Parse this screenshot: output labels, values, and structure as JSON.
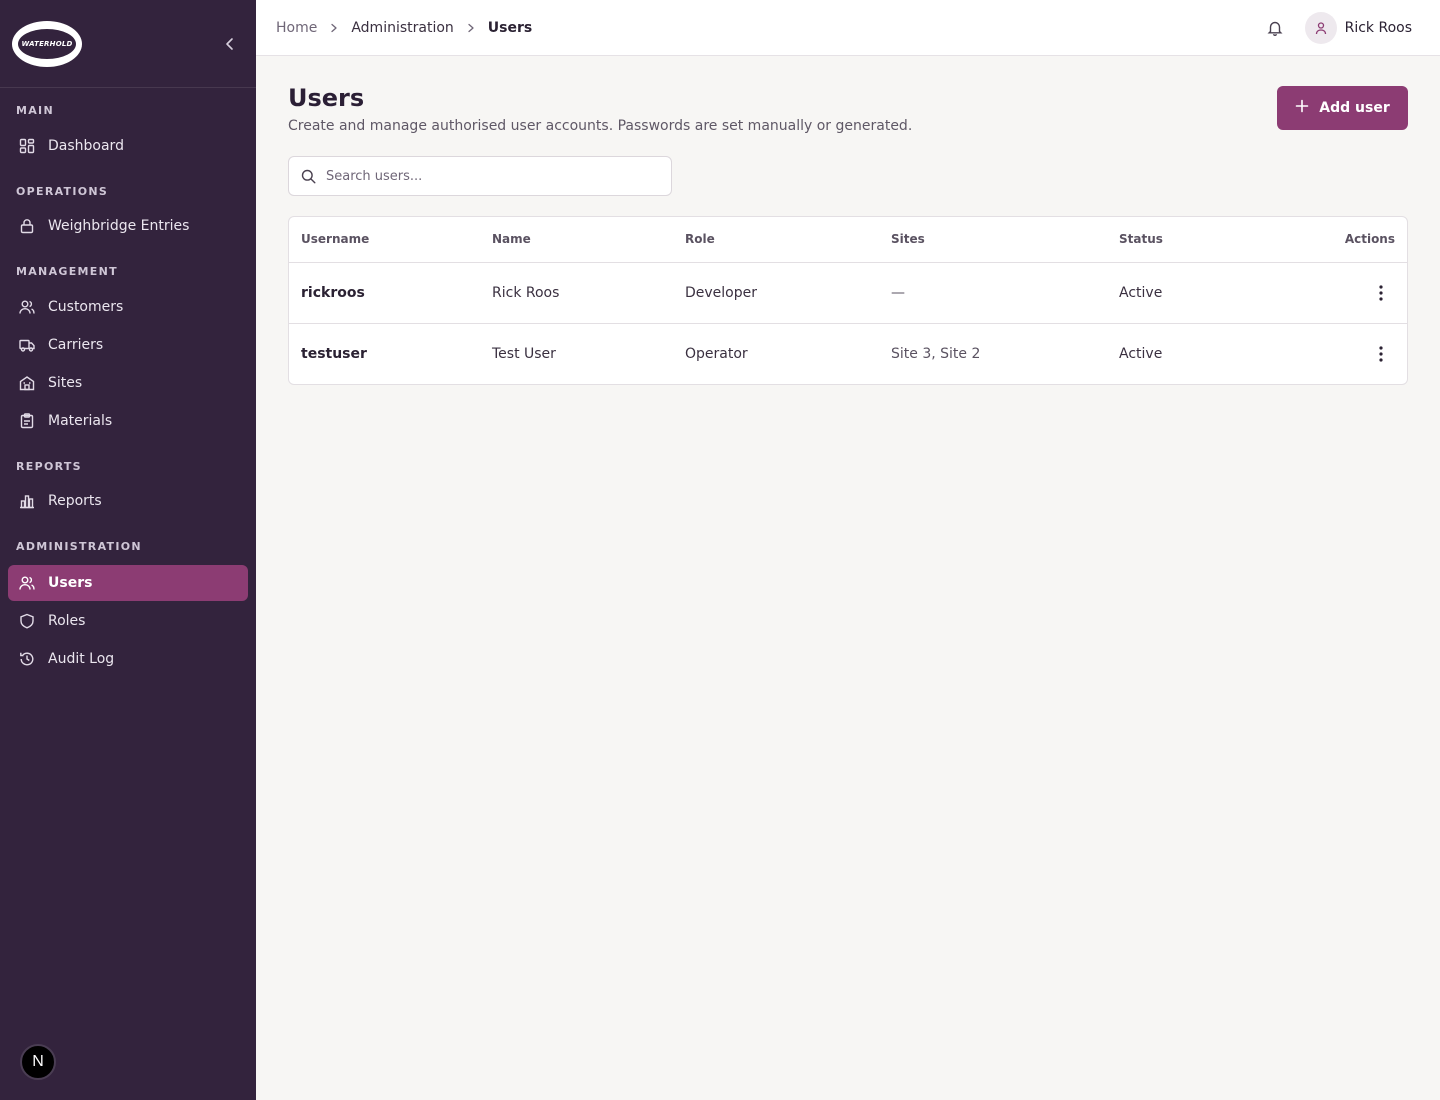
{
  "brand": {
    "logo_text": "WATERHOLD"
  },
  "sidebar": {
    "sections": [
      {
        "label": "MAIN",
        "items": [
          {
            "label": "Dashboard",
            "icon": "dashboard-icon"
          }
        ]
      },
      {
        "label": "OPERATIONS",
        "items": [
          {
            "label": "Weighbridge Entries",
            "icon": "lock-icon"
          }
        ]
      },
      {
        "label": "MANAGEMENT",
        "items": [
          {
            "label": "Customers",
            "icon": "users-icon"
          },
          {
            "label": "Carriers",
            "icon": "truck-icon"
          },
          {
            "label": "Sites",
            "icon": "building-icon"
          },
          {
            "label": "Materials",
            "icon": "clipboard-icon"
          }
        ]
      },
      {
        "label": "REPORTS",
        "items": [
          {
            "label": "Reports",
            "icon": "bar-chart-icon"
          }
        ]
      },
      {
        "label": "ADMINISTRATION",
        "items": [
          {
            "label": "Users",
            "icon": "users-icon",
            "active": true
          },
          {
            "label": "Roles",
            "icon": "shield-icon"
          },
          {
            "label": "Audit Log",
            "icon": "history-icon"
          }
        ]
      }
    ],
    "badge": "N"
  },
  "topbar": {
    "breadcrumb": [
      "Home",
      "Administration",
      "Users"
    ],
    "user_name": "Rick Roos"
  },
  "page": {
    "title": "Users",
    "subtitle": "Create and manage authorised user accounts. Passwords are set manually or generated.",
    "add_button": "Add user",
    "search_placeholder": "Search users..."
  },
  "table": {
    "columns": [
      "Username",
      "Name",
      "Role",
      "Sites",
      "Status",
      "Actions"
    ],
    "rows": [
      {
        "username": "rickroos",
        "name": "Rick Roos",
        "role": "Developer",
        "sites": "—",
        "status": "Active"
      },
      {
        "username": "testuser",
        "name": "Test User",
        "role": "Operator",
        "sites": "Site 3, Site 2",
        "status": "Active"
      }
    ]
  },
  "colors": {
    "sidebar_bg": "#33233d",
    "accent": "#8c3c73",
    "page_bg": "#f7f6f4"
  }
}
